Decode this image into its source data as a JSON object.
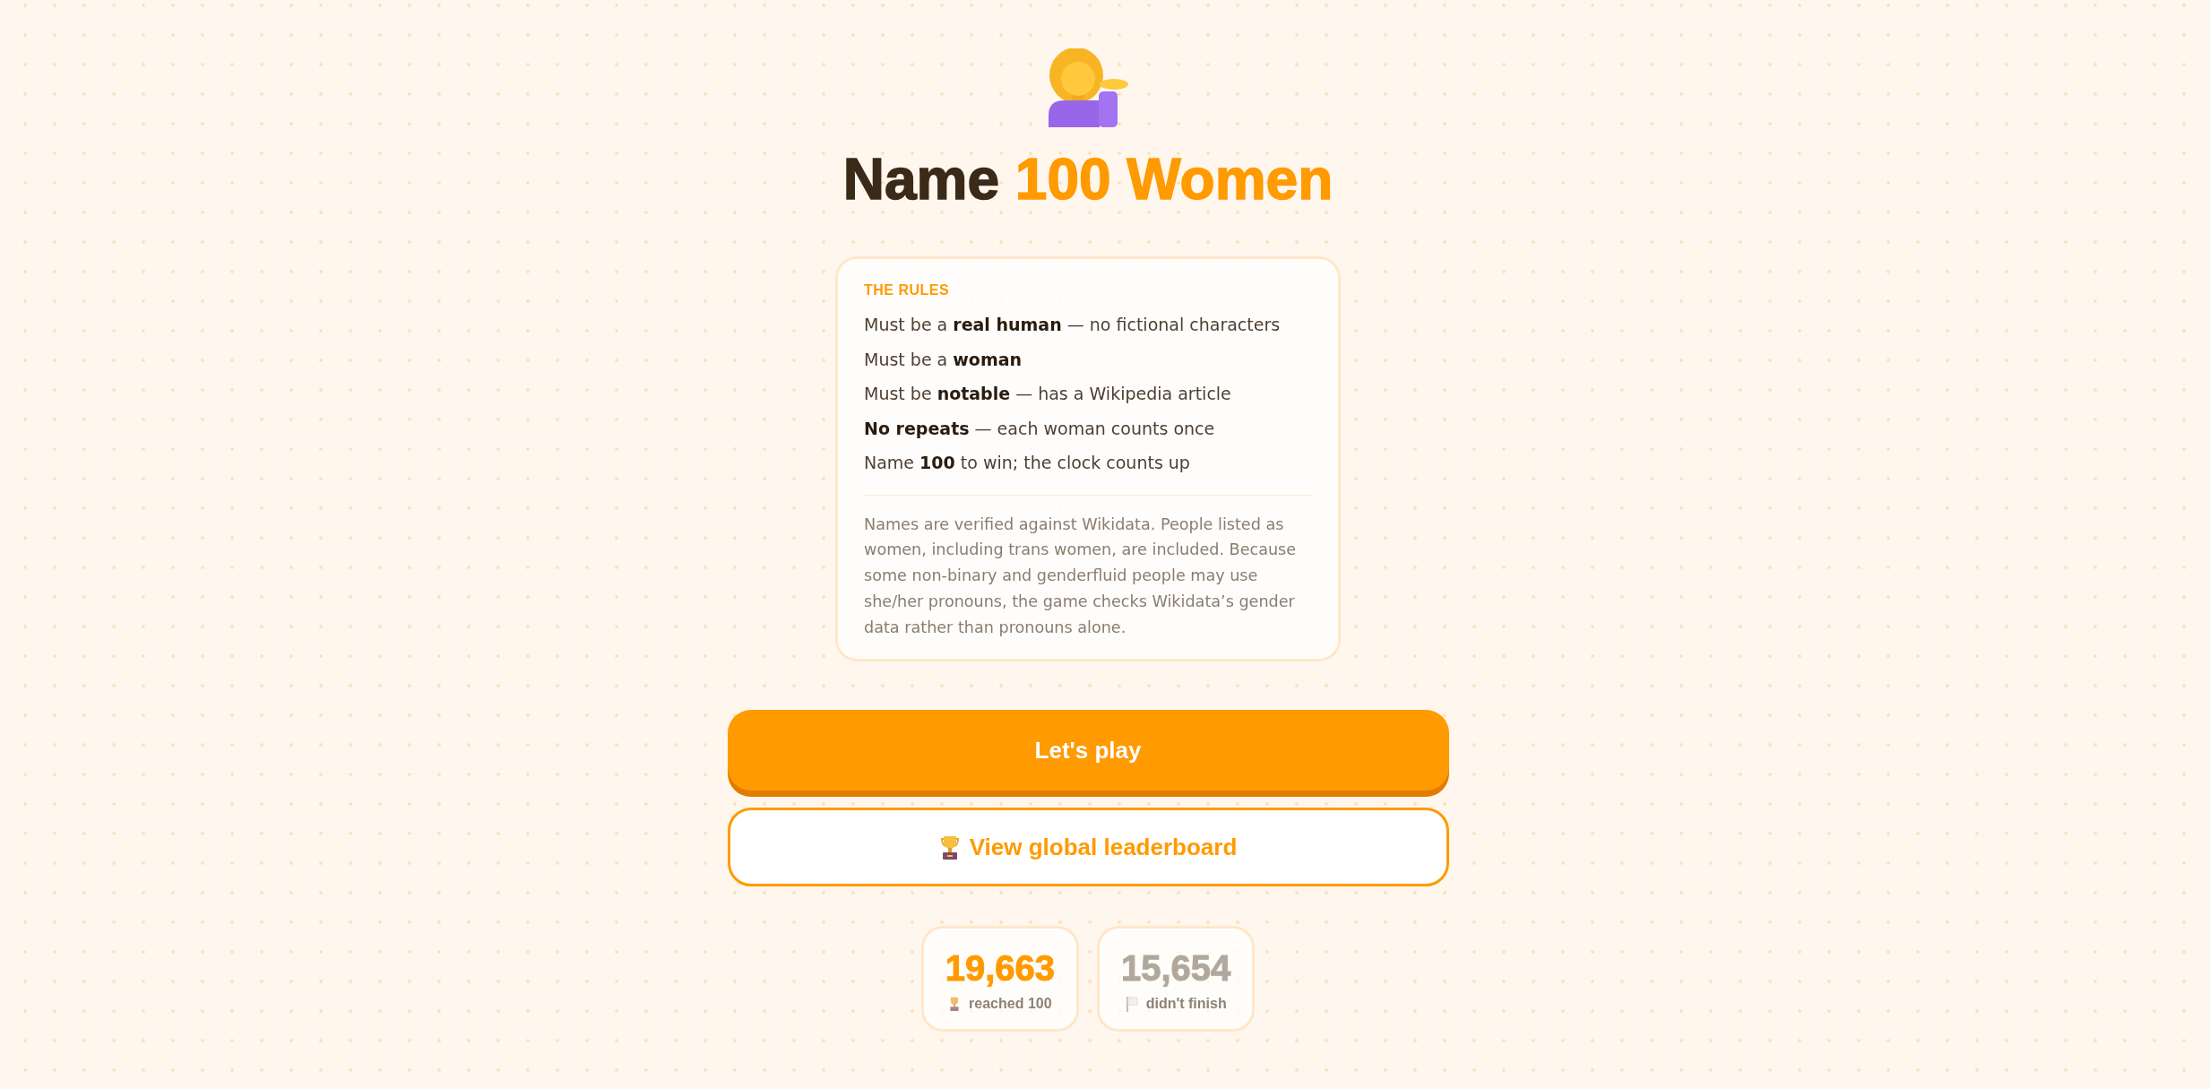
{
  "hero": {
    "title": "Name **100 Women**"
  },
  "rules_card": {
    "heading": "THE RULES",
    "rules": [
      "Must be a **real human** — no fictional characters",
      "Must be a **woman**",
      "Must be **notable** — has a Wikipedia article",
      "**No repeats** — each woman counts once",
      "Name **100** to win; the clock counts up"
    ],
    "note": "Names are verified against Wikidata. People listed as women, including trans women, are included. Because some non-binary and genderfluid people may use she/her pronouns, the game checks Wikidata’s gender data rather than pronouns alone."
  },
  "buttons": [
    {
      "kind": "primary",
      "label": "Let's play"
    },
    {
      "kind": "secondary",
      "label": "View global leaderboard"
    }
  ],
  "stats": [
    {
      "kind": "reached",
      "value": "19,663",
      "label": "reached 100",
      "color": "#ff9a00"
    },
    {
      "kind": "unfinished",
      "value": "15,654",
      "label": "didn't finish",
      "color": "#b1a89d"
    }
  ]
}
